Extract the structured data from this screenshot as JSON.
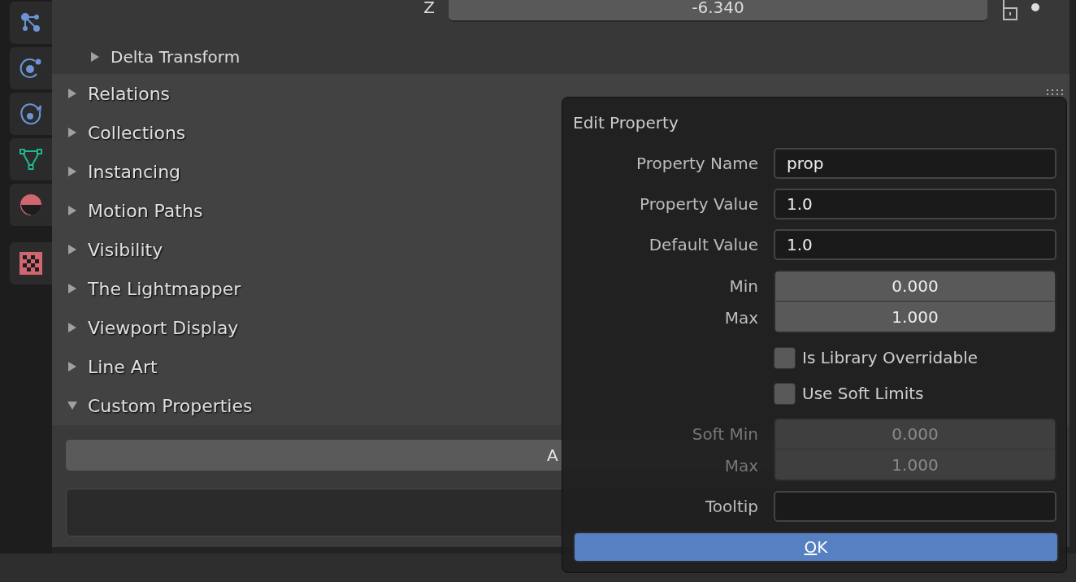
{
  "transform_row": {
    "axis": "Z",
    "value": "-6.340"
  },
  "sub_panel": {
    "label": "Delta Transform",
    "expanded": false
  },
  "panels": [
    {
      "label": "Relations",
      "expanded": false
    },
    {
      "label": "Collections",
      "expanded": false
    },
    {
      "label": "Instancing",
      "expanded": false
    },
    {
      "label": "Motion Paths",
      "expanded": false
    },
    {
      "label": "Visibility",
      "expanded": false
    },
    {
      "label": "The Lightmapper",
      "expanded": false
    },
    {
      "label": "Viewport Display",
      "expanded": false
    },
    {
      "label": "Line Art",
      "expanded": false
    },
    {
      "label": "Custom Properties",
      "expanded": true
    }
  ],
  "custom_properties": {
    "add_button": "A"
  },
  "dialog": {
    "title": "Edit Property",
    "fields": [
      {
        "label": "Property Name",
        "value": "prop"
      },
      {
        "label": "Property Value",
        "value": "1.0"
      },
      {
        "label": "Default Value",
        "value": "1.0"
      }
    ],
    "range": {
      "disabled": false,
      "rows": [
        {
          "label": "Min",
          "value": "0.000"
        },
        {
          "label": "Max",
          "value": "1.000"
        }
      ]
    },
    "checkboxes": [
      {
        "label": "Is Library Overridable",
        "checked": false
      },
      {
        "label": "Use Soft Limits",
        "checked": false
      }
    ],
    "soft_range": {
      "disabled": true,
      "rows": [
        {
          "label": "Soft Min",
          "value": "0.000"
        },
        {
          "label": "Max",
          "value": "1.000"
        }
      ]
    },
    "tooltip": {
      "label": "Tooltip"
    },
    "ok_button": "OK"
  }
}
